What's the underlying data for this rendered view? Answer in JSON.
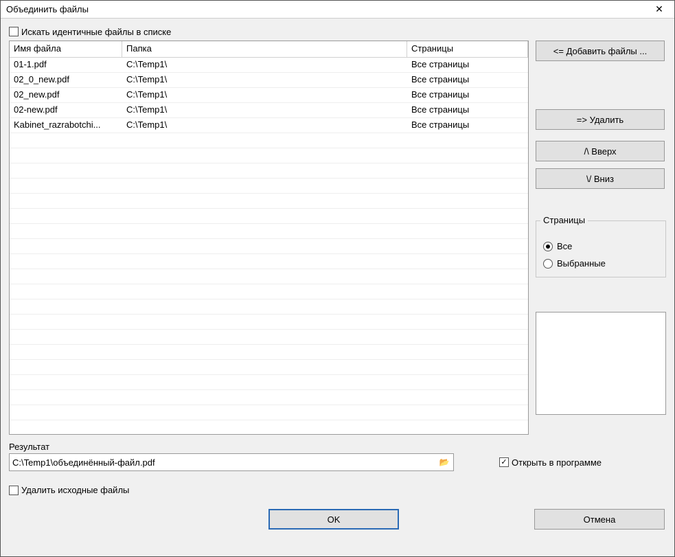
{
  "window": {
    "title": "Объединить файлы"
  },
  "checkboxes": {
    "search_identical": "Искать идентичные файлы в списке",
    "open_in_program": "Открыть в программе",
    "delete_source": "Удалить исходные файлы"
  },
  "table": {
    "headers": {
      "filename": "Имя файла",
      "folder": "Папка",
      "pages": "Страницы"
    },
    "rows": [
      {
        "filename": "01-1.pdf",
        "folder": "C:\\Temp1\\",
        "pages": "Все страницы"
      },
      {
        "filename": "02_0_new.pdf",
        "folder": "C:\\Temp1\\",
        "pages": "Все страницы"
      },
      {
        "filename": "02_new.pdf",
        "folder": "C:\\Temp1\\",
        "pages": "Все страницы"
      },
      {
        "filename": "02-new.pdf",
        "folder": "C:\\Temp1\\",
        "pages": "Все страницы"
      },
      {
        "filename": "Kabinet_razrabotchi...",
        "folder": "C:\\Temp1\\",
        "pages": "Все страницы"
      }
    ]
  },
  "buttons": {
    "add_files": "<= Добавить файлы ...",
    "delete": "=> Удалить",
    "up": "/\\   Вверх",
    "down": "\\/   Вниз",
    "ok": "OK",
    "cancel": "Отмена"
  },
  "pages_group": {
    "legend": "Страницы",
    "all": "Все",
    "selected": "Выбранные"
  },
  "result": {
    "label": "Результат",
    "path": "C:\\Temp1\\объединённый-файл.pdf"
  }
}
